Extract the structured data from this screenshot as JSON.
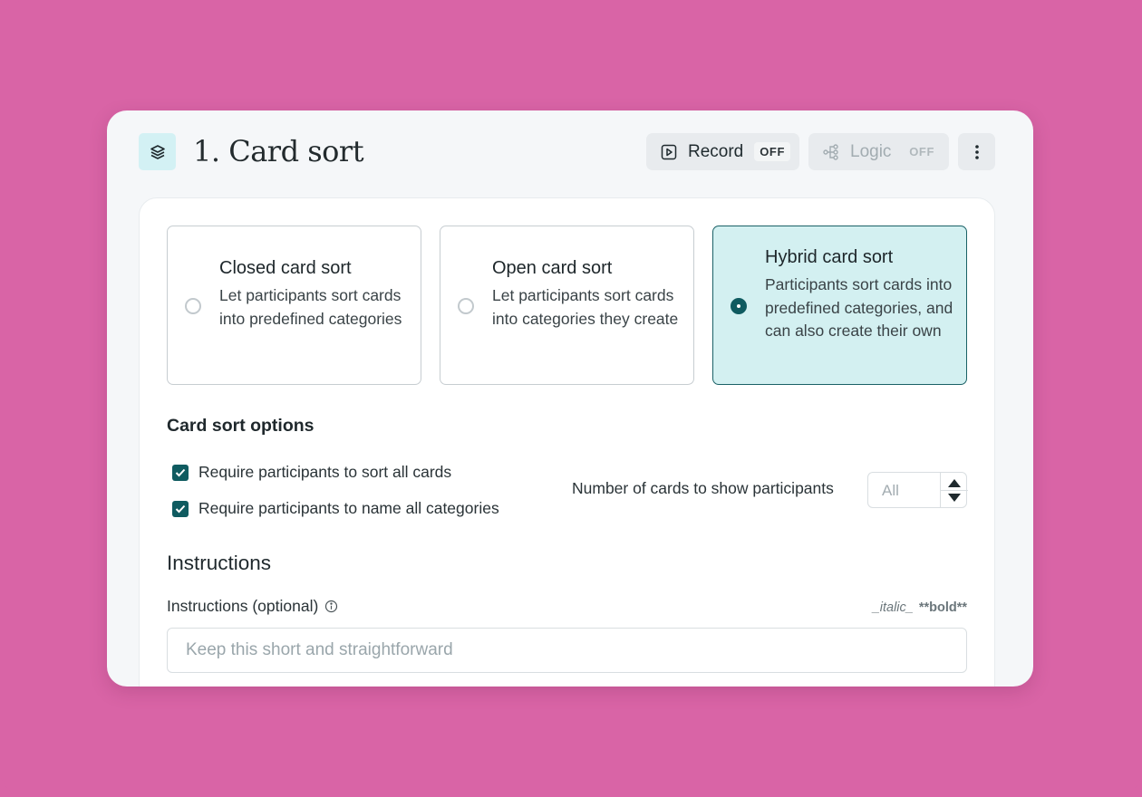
{
  "header": {
    "title": "1. Card sort",
    "record": {
      "label": "Record",
      "state": "OFF"
    },
    "logic": {
      "label": "Logic",
      "state": "OFF"
    }
  },
  "sort_types": [
    {
      "title": "Closed card sort",
      "description": "Let participants sort cards into predefined categories",
      "selected": false
    },
    {
      "title": "Open card sort",
      "description": "Let participants sort cards into categories they create",
      "selected": false
    },
    {
      "title": "Hybrid card sort",
      "description": "Participants sort cards into predefined categories, and can also create their own",
      "selected": true
    }
  ],
  "options": {
    "title": "Card sort options",
    "checkboxes": [
      {
        "label": "Require participants to sort all cards",
        "checked": true
      },
      {
        "label": "Require participants to name all categories",
        "checked": true
      }
    ],
    "num_cards_label": "Number of cards to show participants",
    "num_cards_value": "All"
  },
  "instructions": {
    "title": "Instructions",
    "label": "Instructions (optional)",
    "md_italic": "_italic_",
    "md_bold": "**bold**",
    "placeholder": "Keep this short and straightforward"
  },
  "colors": {
    "background": "#d964a6",
    "accent": "#0f5b60",
    "selected_bg": "#d3f0f1"
  }
}
